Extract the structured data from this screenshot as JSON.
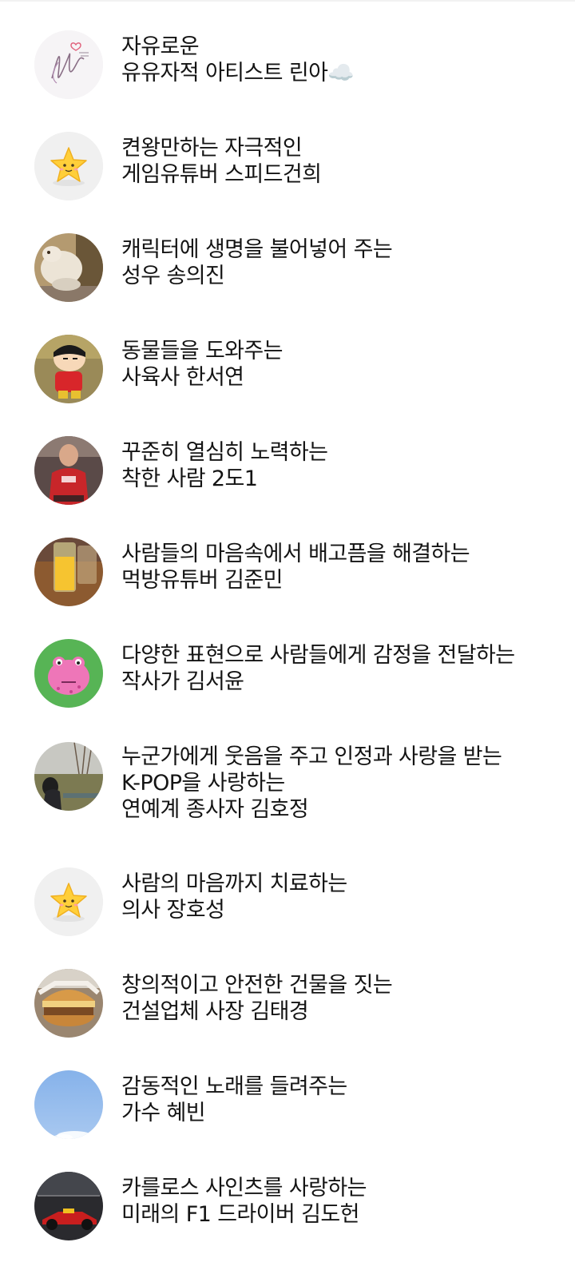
{
  "profiles": [
    {
      "avatar": "signature-heart-avatar",
      "lines": [
        "자유로운",
        "유유자적 아티스트 린아☁️"
      ]
    },
    {
      "avatar": "star-emoji-avatar",
      "lines": [
        "켠왕만하는 자극적인",
        "게임유튜버 스피드건희"
      ]
    },
    {
      "avatar": "stuffed-toy-photo-avatar",
      "lines": [
        "캐릭터에 생명을 불어넣어 주는",
        "성우 송의진"
      ]
    },
    {
      "avatar": "cartoon-boy-avatar",
      "lines": [
        "동물들을 도와주는",
        "사육사 한서연"
      ]
    },
    {
      "avatar": "person-red-shirt-photo-avatar",
      "lines": [
        "꾸준히 열심히 노력하는",
        "착한 사람 2도1"
      ]
    },
    {
      "avatar": "orange-juice-photo-avatar",
      "lines": [
        "사람들의 마음속에서 배고픔을 해결하는",
        "먹방유튜버 김준민"
      ]
    },
    {
      "avatar": "pink-frog-character-avatar",
      "lines": [
        "다양한 표현으로 사람들에게 감정을 전달하는",
        "작사가 김서윤"
      ]
    },
    {
      "avatar": "outdoor-person-photo-avatar",
      "lines": [
        "누군가에게 웃음을 주고 인정과 사랑을 받는",
        "K-POP을 사랑하는",
        "연예계 종사자 김호정"
      ]
    },
    {
      "avatar": "star-emoji-avatar",
      "lines": [
        "사람의 마음까지 치료하는",
        "의사 장호성"
      ]
    },
    {
      "avatar": "burger-photo-avatar",
      "lines": [
        "창의적이고 안전한 건물을 짓는",
        "건설업체 사장 김태경"
      ]
    },
    {
      "avatar": "blue-sky-photo-avatar",
      "lines": [
        "감동적인 노래를 들려주는",
        "가수 혜빈"
      ]
    },
    {
      "avatar": "f1-race-car-photo-avatar",
      "lines": [
        "카를로스 사인츠를 사랑하는",
        "미래의 F1 드라이버 김도헌"
      ]
    }
  ]
}
